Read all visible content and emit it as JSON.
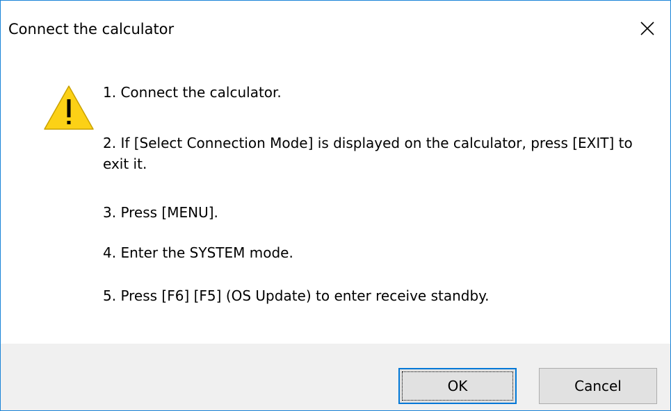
{
  "window": {
    "title": "Connect the calculator",
    "close_icon": "close-icon"
  },
  "message": {
    "icon": "warning-icon",
    "lines": [
      "1. Connect the calculator.",
      "2. If [Select Connection Mode] is displayed on the calculator, press [EXIT] to exit it.",
      "3. Press [MENU].",
      "4. Enter the SYSTEM mode.",
      "5. Press [F6] [F5] (OS Update) to enter receive standby."
    ]
  },
  "buttons": {
    "ok_label": "OK",
    "cancel_label": "Cancel"
  },
  "colors": {
    "border": "#1883d7",
    "footer_bg": "#f0f0f0",
    "button_bg": "#e1e1e1",
    "focus_border": "#0078d7",
    "warning_fill": "#fcd116"
  }
}
